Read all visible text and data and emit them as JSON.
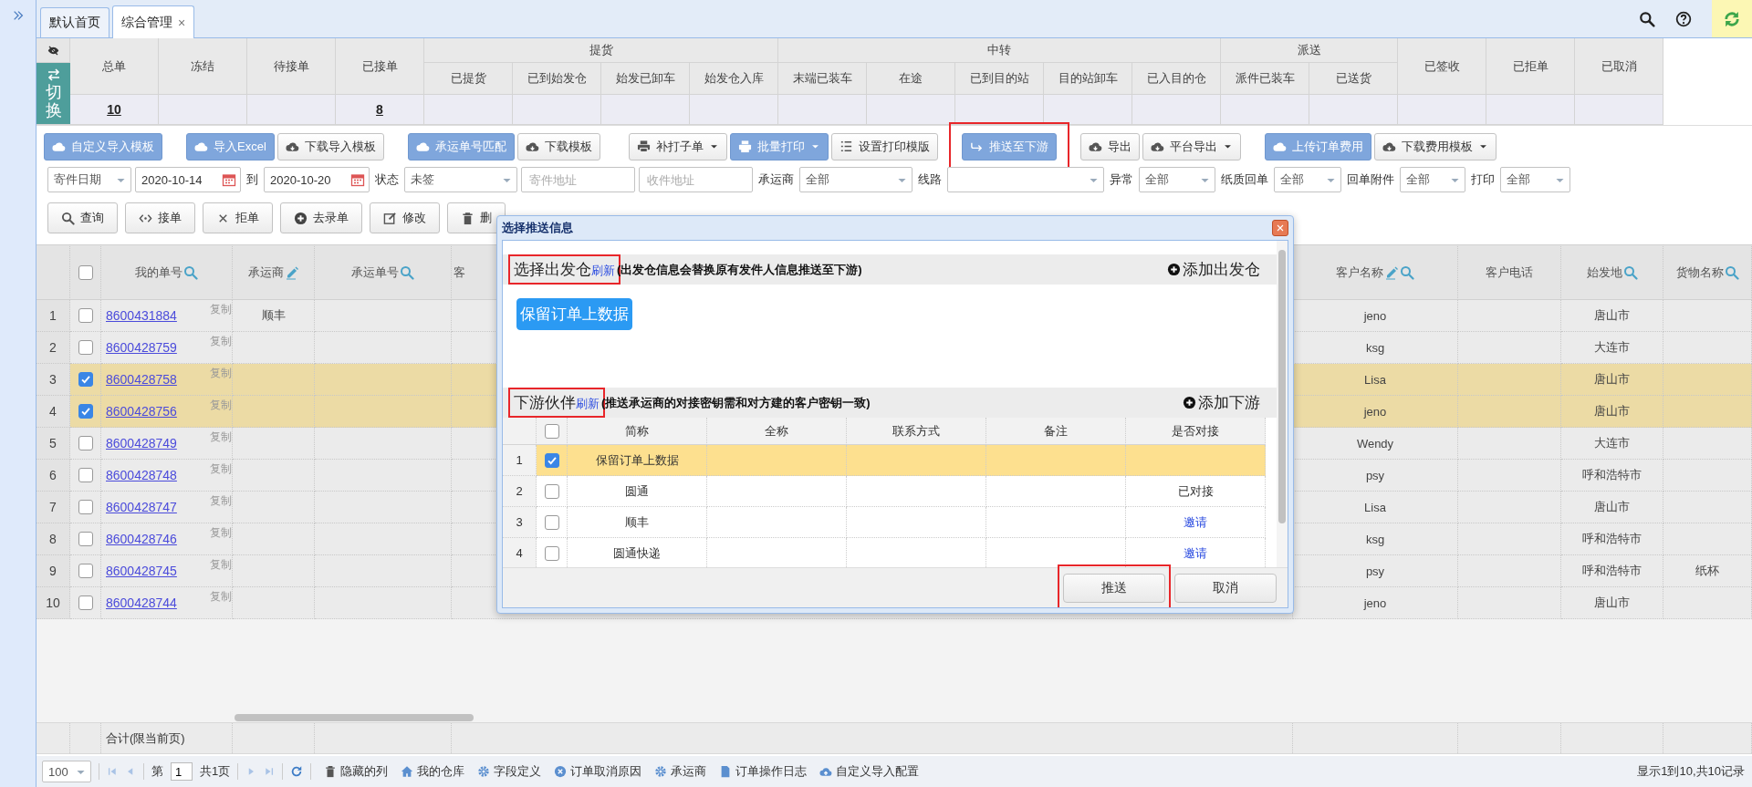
{
  "tabs": [
    {
      "label": "默认首页",
      "selected": false
    },
    {
      "label": "综合管理",
      "selected": true,
      "close": "×"
    }
  ],
  "stats": {
    "toggle_label": "切换",
    "columns": [
      {
        "label": "总单",
        "value": "10"
      },
      {
        "label": "冻结"
      },
      {
        "label": "待接单"
      },
      {
        "label": "已接单",
        "value": "8"
      },
      {
        "label": "提货",
        "children": [
          {
            "label": "已提货"
          },
          {
            "label": "已到始发仓"
          },
          {
            "label": "始发已卸车"
          },
          {
            "label": "始发仓入库"
          }
        ]
      },
      {
        "label": "中转",
        "children": [
          {
            "label": "末端已装车"
          },
          {
            "label": "在途"
          },
          {
            "label": "已到目的站"
          },
          {
            "label": "目的站卸车"
          },
          {
            "label": "已入目的仓"
          }
        ]
      },
      {
        "label": "派送",
        "children": [
          {
            "label": "派件已装车"
          },
          {
            "label": "已送货"
          }
        ]
      },
      {
        "label": "已签收"
      },
      {
        "label": "已拒单"
      },
      {
        "label": "已取消"
      }
    ]
  },
  "toolbar": [
    [
      {
        "label": "自定义导入模板",
        "primary": true
      }
    ],
    [
      {
        "label": "导入Excel",
        "primary": true
      },
      {
        "label": "下载导入模板",
        "primary": false
      }
    ],
    [
      {
        "label": "承运单号匹配",
        "primary": true
      },
      {
        "label": "下载模板",
        "primary": false
      }
    ],
    [
      {
        "label": "补打子单",
        "primary": false,
        "dropdown": true
      },
      {
        "label": "批量打印",
        "primary": true,
        "dropdown": true
      },
      {
        "label": "设置打印模版",
        "primary": false
      }
    ],
    [
      {
        "label": "推送至下游",
        "primary": true,
        "highlighted": true
      }
    ],
    [
      {
        "label": "导出",
        "primary": false
      },
      {
        "label": "平台导出",
        "primary": false,
        "dropdown": true
      }
    ],
    [
      {
        "label": "上传订单费用",
        "primary": true
      },
      {
        "label": "下载费用模板",
        "primary": false,
        "dropdown": true
      }
    ]
  ],
  "filters": [
    {
      "kind": "select",
      "value": "寄件日期"
    },
    {
      "kind": "date",
      "value": "2020-10-14"
    },
    {
      "kind": "label",
      "text": "到"
    },
    {
      "kind": "date",
      "value": "2020-10-20"
    },
    {
      "kind": "label",
      "text": "状态"
    },
    {
      "kind": "select",
      "value": "未签"
    },
    {
      "kind": "text",
      "placeholder": "寄件地址"
    },
    {
      "kind": "text",
      "placeholder": "收件地址"
    },
    {
      "kind": "label",
      "text": "承运商"
    },
    {
      "kind": "select",
      "value": "全部"
    },
    {
      "kind": "label",
      "text": "线路"
    },
    {
      "kind": "select"
    },
    {
      "kind": "label",
      "text": "异常"
    },
    {
      "kind": "select",
      "value": "全部"
    },
    {
      "kind": "label",
      "text": "纸质回单"
    },
    {
      "kind": "select",
      "value": "全部"
    },
    {
      "kind": "label",
      "text": "回单附件"
    },
    {
      "kind": "select",
      "value": "全部"
    },
    {
      "kind": "label",
      "text": "打印"
    },
    {
      "kind": "select",
      "value": "全部"
    }
  ],
  "actions": [
    {
      "label": "查询"
    },
    {
      "label": "接单"
    },
    {
      "label": "拒单"
    },
    {
      "label": "去录单"
    },
    {
      "label": "修改"
    },
    {
      "label": "删"
    }
  ],
  "table": {
    "select_all": {
      "checked": false
    },
    "columns": [
      {
        "label": "我的单号",
        "searchable": true,
        "editable": false
      },
      {
        "label": "承运商",
        "searchable": false,
        "editable": true
      },
      {
        "label": "承运单号",
        "searchable": true,
        "editable": false
      },
      {
        "label": "客",
        "searchable": false,
        "editable": false
      },
      {
        "label": "客户名称",
        "searchable": true,
        "editable": true
      },
      {
        "label": "客户电话",
        "searchable": false,
        "editable": false
      },
      {
        "label": "始发地",
        "searchable": true,
        "editable": false
      },
      {
        "label": "货物名称",
        "searchable": true,
        "editable": false
      }
    ],
    "rows": [
      {
        "num": "1",
        "checked": false,
        "order_no": "8600431884",
        "copy": "复制",
        "carrier": "顺丰",
        "customer": "jeno",
        "origin": "唐山市"
      },
      {
        "num": "2",
        "checked": false,
        "order_no": "8600428759",
        "copy": "复制",
        "customer": "ksg",
        "origin": "大连市"
      },
      {
        "num": "3",
        "checked": true,
        "order_no": "8600428758",
        "copy": "复制",
        "customer": "Lisa",
        "origin": "唐山市"
      },
      {
        "num": "4",
        "checked": true,
        "order_no": "8600428756",
        "copy": "复制",
        "customer": "jeno",
        "origin": "唐山市"
      },
      {
        "num": "5",
        "checked": false,
        "order_no": "8600428749",
        "copy": "复制",
        "customer": "Wendy",
        "origin": "大连市"
      },
      {
        "num": "6",
        "checked": false,
        "order_no": "8600428748",
        "copy": "复制",
        "customer": "psy",
        "origin": "呼和浩特市"
      },
      {
        "num": "7",
        "checked": false,
        "order_no": "8600428747",
        "copy": "复制",
        "customer": "Lisa",
        "origin": "唐山市"
      },
      {
        "num": "8",
        "checked": false,
        "order_no": "8600428746",
        "copy": "复制",
        "customer": "ksg",
        "origin": "呼和浩特市"
      },
      {
        "num": "9",
        "checked": false,
        "order_no": "8600428745",
        "copy": "复制",
        "customer": "psy",
        "origin": "呼和浩特市",
        "goods": "纸杯"
      },
      {
        "num": "10",
        "checked": false,
        "order_no": "8600428744",
        "copy": "复制",
        "customer": "jeno",
        "origin": "唐山市"
      }
    ],
    "summary": "合计(限当前页)"
  },
  "pager": {
    "page_size": "100",
    "page_prefix": "第",
    "page": "1",
    "page_suffix": "共1页",
    "links": [
      "隐藏的列",
      "我的仓库",
      "字段定义",
      "订单取消原因",
      "承运商",
      "订单操作日志",
      "自定义导入配置"
    ],
    "info": "显示1到10,共10记录"
  },
  "dialog": {
    "title": "选择推送信息",
    "warehouse": {
      "heading": "选择出发仓",
      "refresh": "刷新",
      "note": "(出发仓信息会替换原有发件人信息推送至下游)",
      "add": "添加出发仓",
      "highlighted": true,
      "options": [
        {
          "label": "保留订单上数据",
          "selected": true
        }
      ]
    },
    "partners": {
      "heading": "下游伙伴",
      "refresh": "刷新",
      "note": "(推送承运商的对接密钥需和对方建的客户密钥一致)",
      "add": "添加下游",
      "highlighted": true,
      "select_all": {
        "checked": false
      },
      "columns": [
        "简称",
        "全称",
        "联系方式",
        "备注",
        "是否对接"
      ],
      "rows": [
        {
          "num": "1",
          "checked": true,
          "short_name": "保留订单上数据"
        },
        {
          "num": "2",
          "checked": false,
          "short_name": "圆通",
          "status": "已对接",
          "kind": "text"
        },
        {
          "num": "3",
          "checked": false,
          "short_name": "顺丰",
          "status": "邀请",
          "kind": "link"
        },
        {
          "num": "4",
          "checked": false,
          "short_name": "圆通快递",
          "status": "邀请",
          "kind": "link"
        }
      ]
    },
    "buttons": [
      {
        "label": "推送",
        "highlighted": true
      },
      {
        "label": "取消",
        "highlighted": false
      }
    ]
  }
}
